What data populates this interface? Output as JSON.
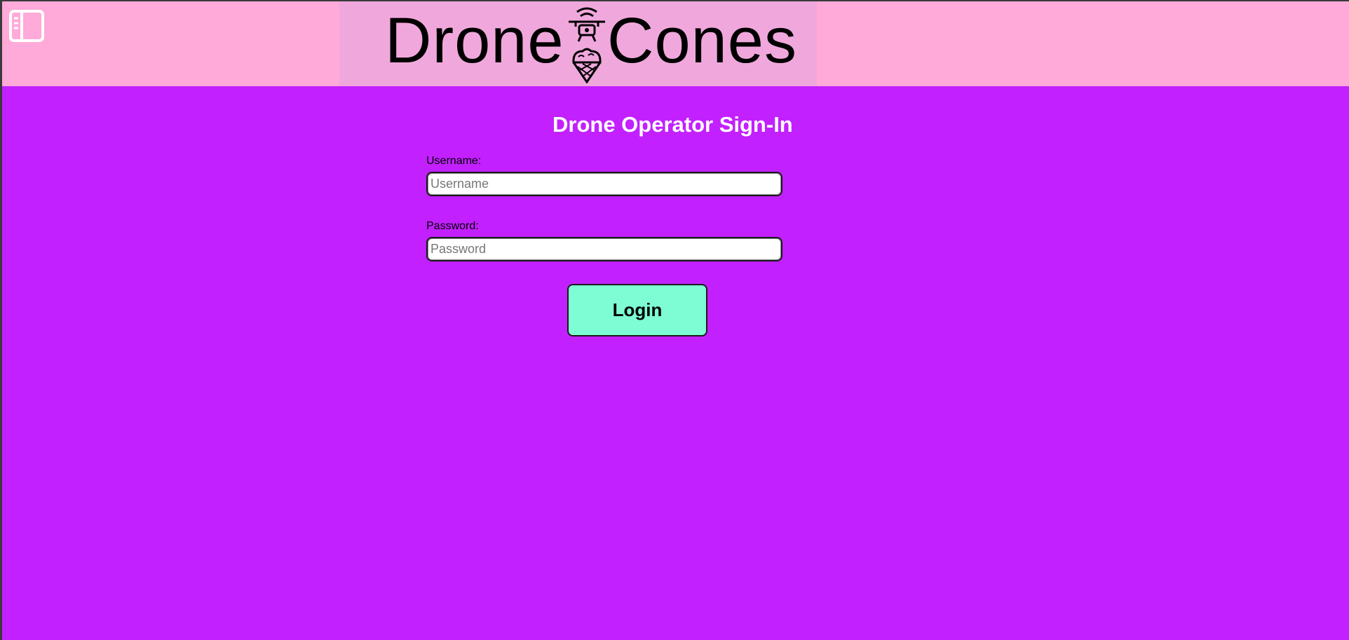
{
  "header": {
    "logo_left": "Drone",
    "logo_right": "Cones",
    "sidebar_toggle_icon": "sidebar-panel-icon",
    "logo_icon": "drone-ice-cream-icon"
  },
  "login": {
    "title": "Drone Operator Sign-In",
    "username_label": "Username:",
    "username_placeholder": "Username",
    "username_value": "",
    "password_label": "Password:",
    "password_placeholder": "Password",
    "password_value": "",
    "submit_label": "Login"
  },
  "colors": {
    "header_background": "#ffaad8",
    "logo_panel_background": "#f0a8dc",
    "page_background": "#c220ff",
    "button_background": "#7efcd4",
    "title_color": "#ffffff"
  }
}
